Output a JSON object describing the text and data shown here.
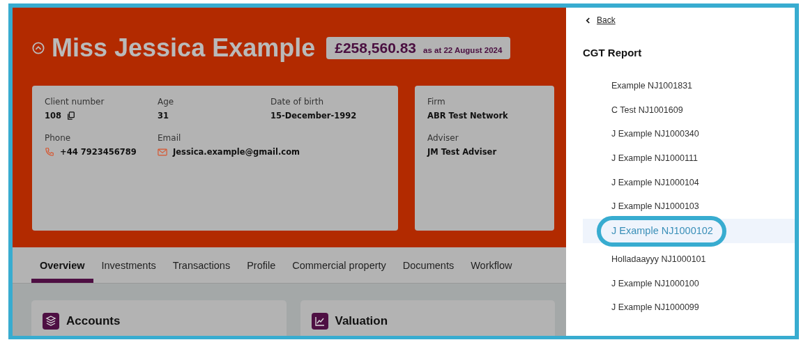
{
  "client": {
    "name": "Miss Jessica Example",
    "value": "£258,560.83",
    "value_date": "as at 22 August 2024"
  },
  "details": [
    {
      "label": "Client number",
      "value": "108",
      "kind": "copy"
    },
    {
      "label": "Age",
      "value": "31",
      "kind": "plain"
    },
    {
      "label": "Date of birth",
      "value": "15-December-1992",
      "kind": "plain"
    },
    {
      "label": "Phone",
      "value": "+44 7923456789",
      "kind": "phone"
    },
    {
      "label": "Email",
      "value": "Jessica.example@gmail.com",
      "kind": "email"
    }
  ],
  "firm_details": [
    {
      "label": "Firm",
      "value": "ABR Test Network"
    },
    {
      "label": "Adviser",
      "value": "JM Test Adviser"
    }
  ],
  "tabs": [
    {
      "label": "Overview",
      "selected": true
    },
    {
      "label": "Investments",
      "selected": false
    },
    {
      "label": "Transactions",
      "selected": false
    },
    {
      "label": "Profile",
      "selected": false
    },
    {
      "label": "Commercial property",
      "selected": false
    },
    {
      "label": "Documents",
      "selected": false
    },
    {
      "label": "Workflow",
      "selected": false
    }
  ],
  "cards": [
    {
      "title": "Accounts",
      "kind": "layers"
    },
    {
      "title": "Valuation",
      "kind": "chart"
    }
  ],
  "panel": {
    "back": "Back",
    "title": "CGT Report",
    "items": [
      {
        "label": "Example NJ1001831",
        "selected": false
      },
      {
        "label": "C Test NJ1001609",
        "selected": false
      },
      {
        "label": "J Example NJ1000340",
        "selected": false
      },
      {
        "label": "J Example NJ1000111",
        "selected": false
      },
      {
        "label": "J Example NJ1000104",
        "selected": false
      },
      {
        "label": "J Example NJ1000103",
        "selected": false
      },
      {
        "label": "J Example NJ1000102",
        "selected": true
      },
      {
        "label": "Holladaayyy NJ1000101",
        "selected": false
      },
      {
        "label": "J Example NJ1000100",
        "selected": false
      },
      {
        "label": "J Example NJ1000099",
        "selected": false
      }
    ]
  }
}
